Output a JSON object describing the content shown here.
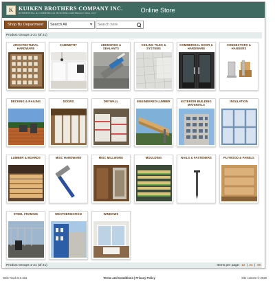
{
  "header": {
    "logo_mark": "K",
    "brand_name": "KUIKEN BROTHERS COMPANY INC.",
    "brand_sub": "RESIDENTIAL & COMMERCIAL BUILDING MATERIALS Since 1917",
    "online_store": "Online Store"
  },
  "toolbar": {
    "shop_label": "Shop By Department",
    "select_value": "Search All",
    "search_placeholder": "Search here"
  },
  "group_header": "Product Groups 1-21 (of 21)",
  "categories": [
    {
      "label": "ARCHITECTURAL HARDWARE"
    },
    {
      "label": "CABINETRY"
    },
    {
      "label": "ADHESIVES & SEALANTS"
    },
    {
      "label": "CEILING TILES & SYSTEMS"
    },
    {
      "label": "COMMERCIAL DOOR & HARDWARE"
    },
    {
      "label": "CONNECTORS & HANGERS"
    },
    {
      "label": "DECKING & RAILING"
    },
    {
      "label": "DOORS"
    },
    {
      "label": "DRYWALL"
    },
    {
      "label": "ENGINEERED LUMBER"
    },
    {
      "label": "EXTERIOR BUILDING MATERIALS"
    },
    {
      "label": "INSULATION"
    },
    {
      "label": "LUMBER & BOARDS"
    },
    {
      "label": "MISC HARDWARE"
    },
    {
      "label": "MISC MILLWORK"
    },
    {
      "label": "MOULDING"
    },
    {
      "label": "NAILS & FASTENERS"
    },
    {
      "label": "PLYWOOD & PANELS"
    },
    {
      "label": "STEEL FRAMING"
    },
    {
      "label": "WEATHERIZATION"
    },
    {
      "label": "WINDOWS"
    }
  ],
  "bottom_bar": {
    "groups": "Product Groups 1-21 (of 21)",
    "items_per_page": "Items per page:",
    "opt1": "12",
    "sep1": "|",
    "opt2": "24",
    "sep2": "|",
    "opt3": "48"
  },
  "footer": {
    "version": "Web Track 6.0.153",
    "links": "Terms and Conditions | Privacy Policy",
    "copyright": "Site content © 2020"
  },
  "colors": {
    "header_bg": "#3f6a61",
    "accent_brown": "#8b4e1e",
    "bar_bg": "#e4ecec"
  }
}
